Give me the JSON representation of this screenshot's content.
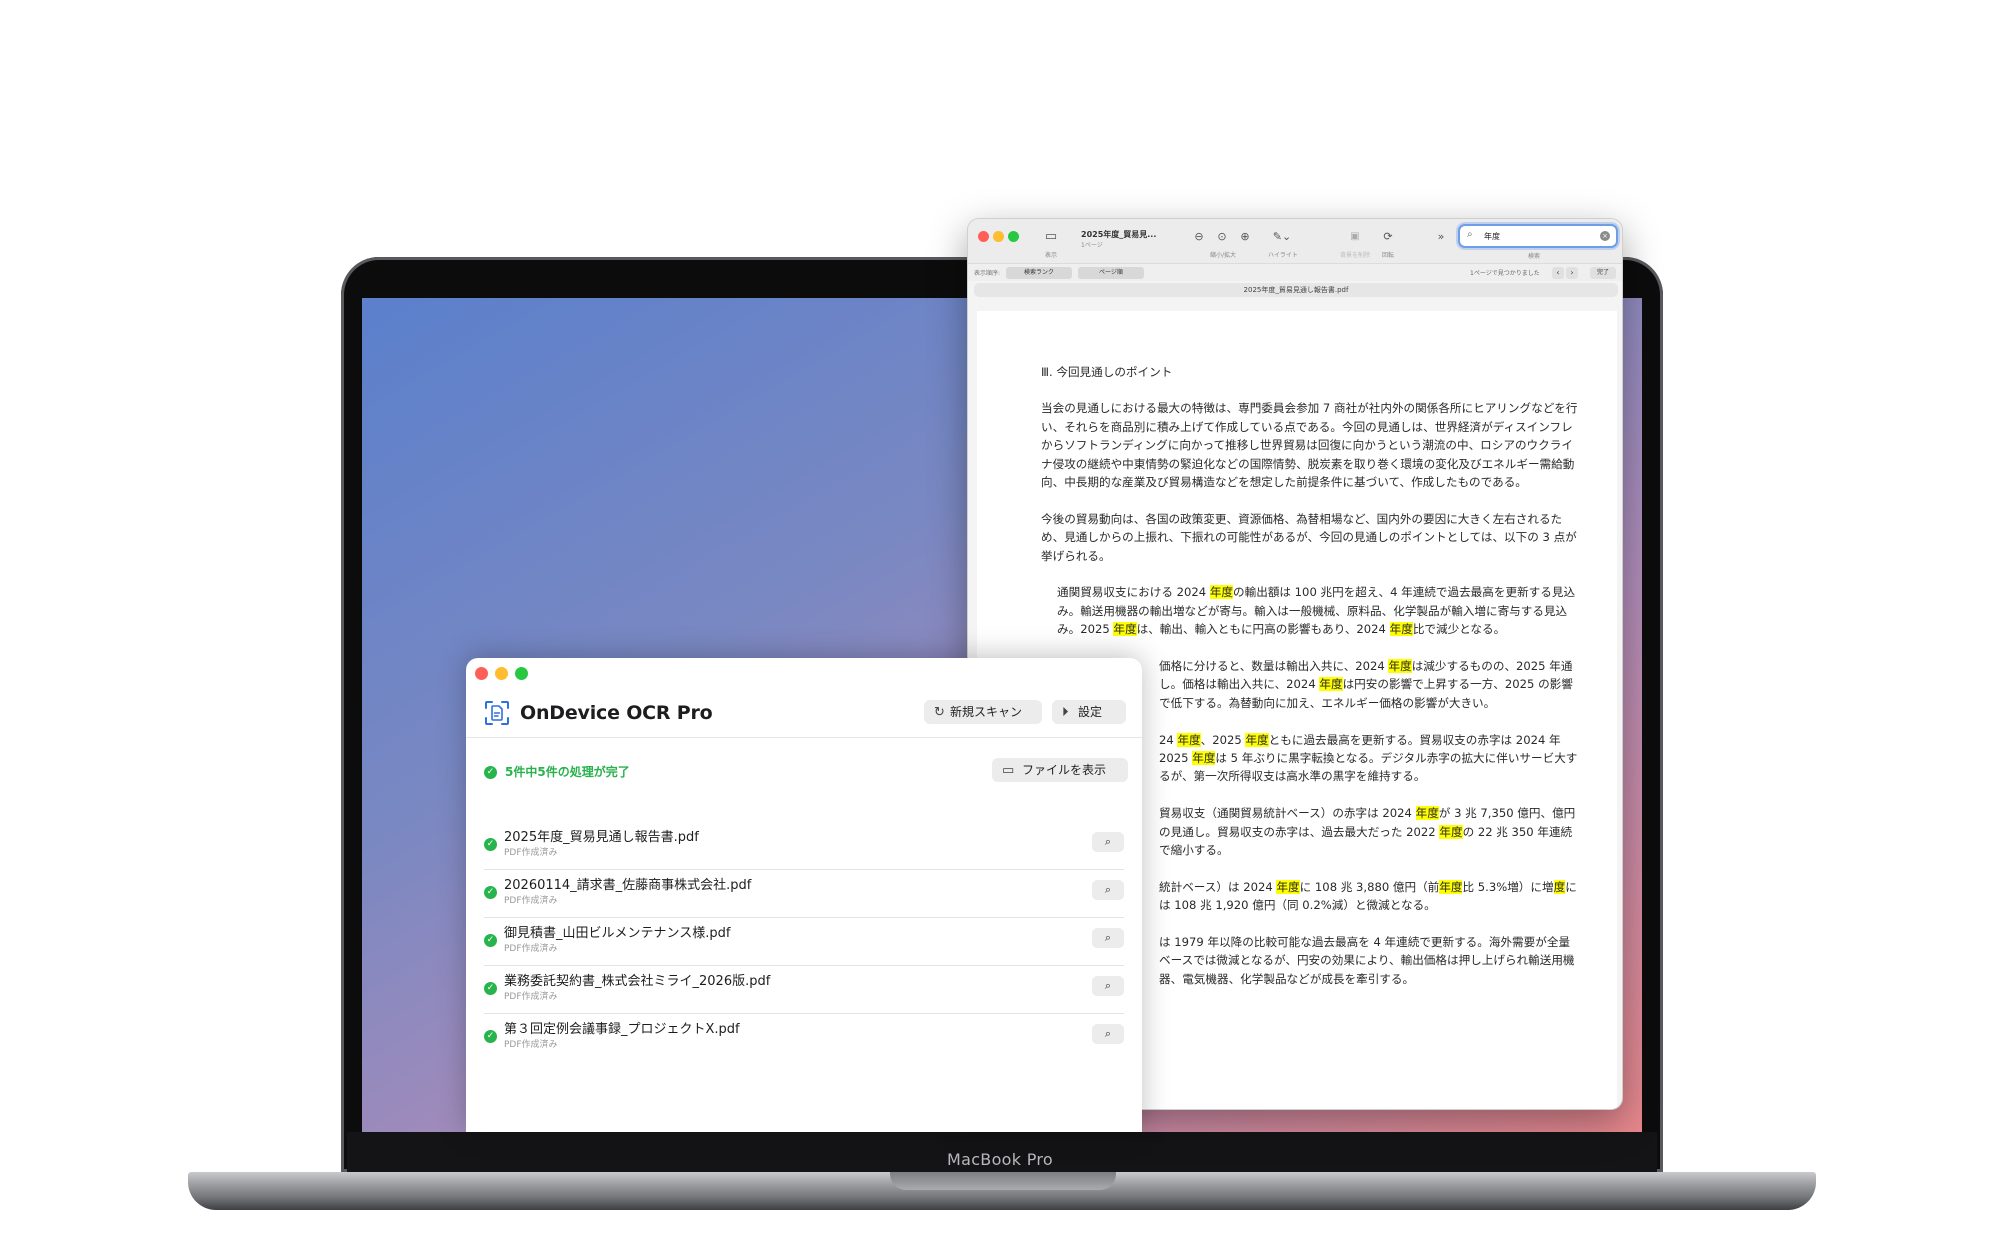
{
  "device": {
    "brand": "MacBook Pro"
  },
  "preview": {
    "title": "2025年度_貿易見...",
    "subtitle": "1ページ",
    "toolbar": {
      "view_caption": "表示",
      "zoom_caption": "縮小/拡大",
      "highlight_caption": "ハイライト",
      "markup_caption": "背景を削除",
      "rotate_caption": "回転",
      "search_caption": "検索"
    },
    "search": {
      "value": "年度"
    },
    "result_bar": {
      "label": "表示順序:",
      "rank_label": "検索ランク",
      "page_label": "ページ順",
      "found_text": "1ページで見つかりました",
      "prev": "‹",
      "next": "›",
      "done_label": "完了"
    },
    "file_tab": "2025年度_貿易見通し報告書.pdf",
    "document": {
      "heading": "Ⅲ. 今回見通しのポイント",
      "p1": "当会の見通しにおける最大の特徴は、専門委員会参加 7 商社が社内外の関係各所にヒアリングなどを行い、それらを商品別に積み上げて作成している点である。今回の見通しは、世界経済がディスインフレからソフトランディングに向かって推移し世界貿易は回復に向かうという潮流の中、ロシアのウクライナ侵攻の継続や中東情勢の緊迫化などの国際情勢、脱炭素を取り巻く環境の変化及びエネルギー需給動向、中長期的な産業及び貿易構造などを想定した前提条件に基づいて、作成したものである。",
      "p2": "今後の貿易動向は、各国の政策変更、資源価格、為替相場など、国内外の要因に大きく左右されるため、見通しからの上振れ、下振れの可能性があるが、今回の見通しのポイントとしては、以下の 3 点が挙げられる。",
      "p3": [
        "通関貿易収支における 2024 ",
        "年度",
        "の輸出額は 100 兆円を超え、4 年連続で過去最高を更新する見込み。輸送用機器の輸出増などが寄与。輸入は一般機械、原料品、化学製品が輸入増に寄与する見込み。2025 ",
        "年度",
        "は、輸出、輸入ともに円高の影響もあり、2024 ",
        "年度",
        "比で減少となる。"
      ],
      "p4": [
        "価格に分けると、数量は輸出入共に、2024 ",
        "年度",
        "は減少するものの、2025 年通し。価格は輸出入共に、2024 ",
        "年度",
        "は円安の影響で上昇する一方、2025 の影響で低下する。為替動向に加え、エネルギー価格の影響が大きい。"
      ],
      "p5": [
        "24 ",
        "年度",
        "、2025 ",
        "年度",
        "ともに過去最高を更新する。貿易収支の赤字は 2024 年 2025 ",
        "年度",
        "は 5 年ぶりに黒字転換となる。デジタル赤字の拡大に伴いサービ大するが、第一次所得収支は高水準の黒字を維持する。"
      ],
      "p6": [
        "貿易収支（通関貿易統計ベース）の赤字は 2024 ",
        "年度",
        "が 3 兆 7,350 億円、億円の見通し。貿易収支の赤字は、過去最大だった 2022 ",
        "年度",
        "の 22 兆 350 年連続で縮小する。"
      ],
      "p7": [
        "統計ベース）は 2024 ",
        "年度",
        "に 108 兆 3,880 億円（前",
        "年度",
        "比 5.3%増）に増",
        "度",
        "には 108 兆 1,920 億円（同 0.2%減）と微減となる。"
      ],
      "p8": "は 1979 年以降の比較可能な過去最高を 4 年連続で更新する。海外需要が全量ベースでは微減となるが、円安の効果により、輸出価格は押し上げられ輸送用機器、電気機器、化学製品などが成長を牽引する。"
    }
  },
  "ocr_app": {
    "app_title": "OnDevice OCR Pro",
    "new_scan_label": "新規スキャン",
    "settings_label": "設定",
    "status_text": "5件中5件の処理が完了",
    "show_files_label": "ファイルを表示",
    "files": [
      {
        "name": "2025年度_貿易見通し報告書.pdf",
        "status": "PDF作成済み"
      },
      {
        "name": "20260114_請求書_佐藤商事株式会社.pdf",
        "status": "PDF作成済み"
      },
      {
        "name": "御見積書_山田ビルメンテナンス様.pdf",
        "status": "PDF作成済み"
      },
      {
        "name": "業務委託契約書_株式会社ミライ_2026版.pdf",
        "status": "PDF作成済み"
      },
      {
        "name": "第３回定例会議事録_プロジェクトX.pdf",
        "status": "PDF作成済み"
      }
    ]
  },
  "colors": {
    "accent_blue": "#2f6fe0",
    "success_green": "#28b44c",
    "highlight_yellow": "#ffff00",
    "close_red": "#ff5f57",
    "minimize_yellow": "#febc2e",
    "zoom_green": "#28c840"
  },
  "icons": {
    "search": "magnifier-icon",
    "new_scan": "refresh-icon",
    "settings": "play-circle-icon",
    "folder": "folder-icon",
    "check": "checkmark-circle-icon"
  }
}
